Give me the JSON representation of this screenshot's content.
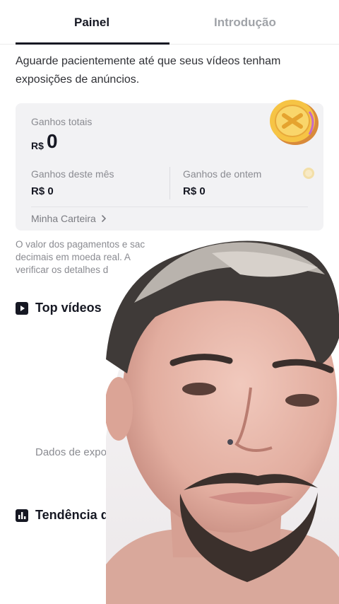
{
  "tabs": [
    {
      "label": "Painel",
      "active": true
    },
    {
      "label": "Introdução",
      "active": false
    }
  ],
  "notice": "Aguarde pacientemente até que seus vídeos tenham exposições de anúncios.",
  "earnings": {
    "total_label": "Ganhos totais",
    "total_currency": "R$",
    "total_value": "0",
    "month_label": "Ganhos deste mês",
    "month_value": "R$ 0",
    "yesterday_label": "Ganhos de ontem",
    "yesterday_value": "R$ 0",
    "wallet_link": "Minha Carteira",
    "wallet_icon": "chevron-right-icon"
  },
  "disclaimer": {
    "line1": "O valor dos pagamentos e sac",
    "line2": "decimais em moeda real. A",
    "line3": "verificar os detalhes d"
  },
  "sections": {
    "top_videos": {
      "title": "Top vídeos",
      "icon": "play-square-icon",
      "empty_text": "Dados de expos"
    },
    "trend": {
      "title": "Tendência de G",
      "icon": "bar-chart-icon"
    }
  },
  "colors": {
    "text": "#161823",
    "muted": "#8a8b91",
    "tab_inactive": "#a0a3a8",
    "card_bg": "#f2f2f4",
    "coin_gold": "#f6c445"
  }
}
